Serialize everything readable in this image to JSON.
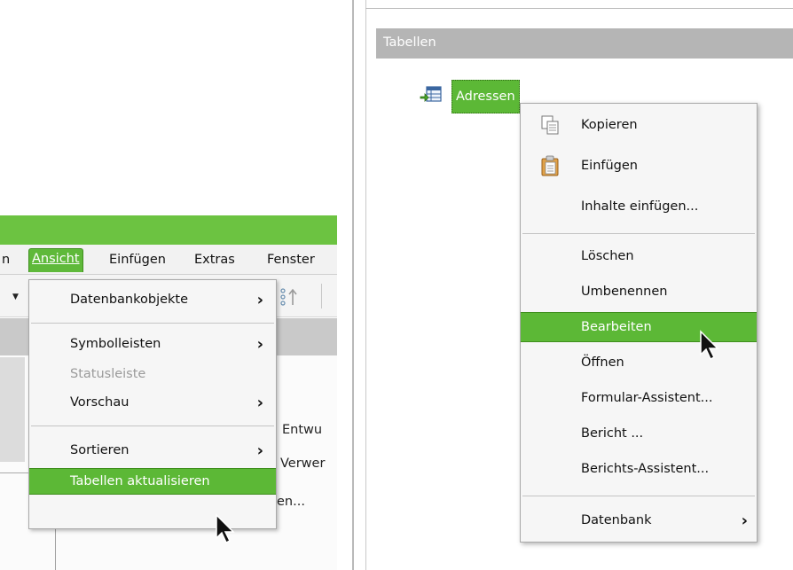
{
  "left": {
    "menubar": [
      {
        "id": "partial",
        "label": "n",
        "active": false
      },
      {
        "id": "ansicht",
        "label": "Ansicht",
        "active": true
      },
      {
        "id": "einfuegen",
        "label": "Einfügen",
        "active": false
      },
      {
        "id": "extras",
        "label": "Extras",
        "active": false
      },
      {
        "id": "fenster",
        "label": "Fenster",
        "active": false
      }
    ],
    "dropdown": [
      {
        "label": "Datenbankobjekte",
        "submenu": true,
        "state": "normal"
      },
      {
        "label": "Symbolleisten",
        "submenu": true,
        "state": "normal"
      },
      {
        "label": "Statusleiste",
        "submenu": false,
        "state": "disabled"
      },
      {
        "label": "Vorschau",
        "submenu": true,
        "state": "normal"
      },
      {
        "label": "Sortieren",
        "submenu": true,
        "state": "normal"
      },
      {
        "label": "Tabellen aktualisieren",
        "submenu": false,
        "state": "highlighted"
      }
    ],
    "behind_text": [
      "Entwu",
      "Verwer",
      "en..."
    ]
  },
  "right": {
    "section_title": "Tabellen",
    "table_item": "Adressen",
    "context_menu": [
      {
        "label": "Kopieren",
        "icon": "copy-icon",
        "submenu": false,
        "state": "normal"
      },
      {
        "label": "Einfügen",
        "icon": "paste-icon",
        "submenu": false,
        "state": "normal"
      },
      {
        "label": "Inhalte einfügen...",
        "icon": "",
        "submenu": false,
        "state": "normal"
      },
      {
        "label": "Löschen",
        "icon": "",
        "submenu": false,
        "state": "normal"
      },
      {
        "label": "Umbenennen",
        "icon": "",
        "submenu": false,
        "state": "normal"
      },
      {
        "label": "Bearbeiten",
        "icon": "",
        "submenu": false,
        "state": "highlighted"
      },
      {
        "label": "Öffnen",
        "icon": "",
        "submenu": false,
        "state": "normal"
      },
      {
        "label": "Formular-Assistent...",
        "icon": "",
        "submenu": false,
        "state": "normal"
      },
      {
        "label": "Bericht ...",
        "icon": "",
        "submenu": false,
        "state": "normal"
      },
      {
        "label": "Berichts-Assistent...",
        "icon": "",
        "submenu": false,
        "state": "normal"
      },
      {
        "label": "Datenbank",
        "icon": "",
        "submenu": true,
        "state": "normal"
      }
    ]
  },
  "colors": {
    "accent_green": "#5cb836",
    "menu_background": "#f6f6f6",
    "header_gray": "#b5b5b5"
  }
}
